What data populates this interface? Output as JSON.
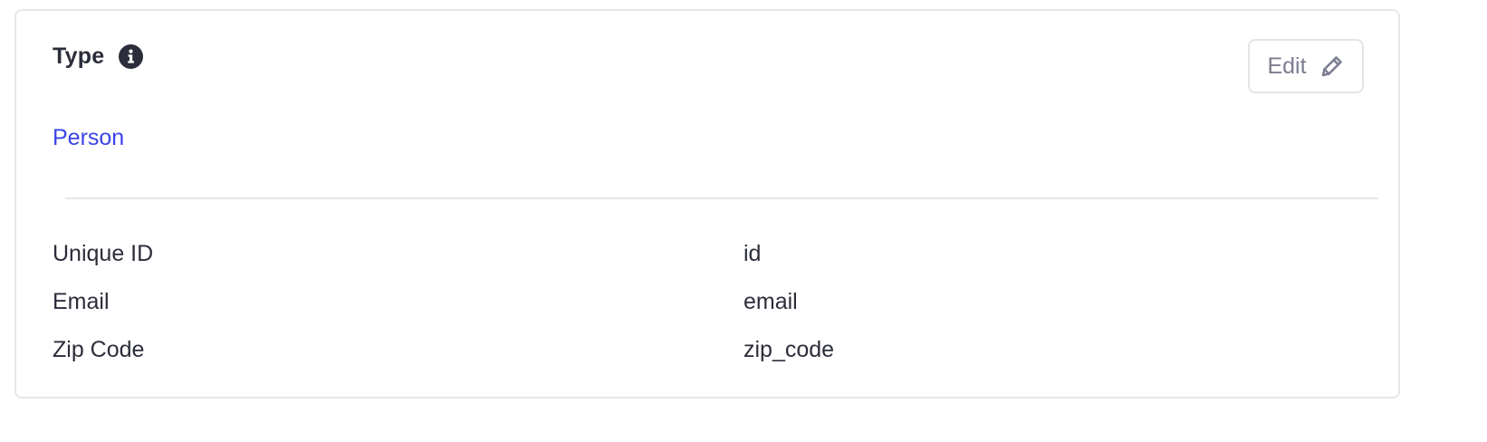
{
  "section": {
    "title": "Type",
    "info_icon": "info-icon",
    "edit_label": "Edit",
    "edit_icon": "pencil-icon",
    "type_value": "Person"
  },
  "fields": [
    {
      "label": "Unique ID",
      "value": "id"
    },
    {
      "label": "Email",
      "value": "email"
    },
    {
      "label": "Zip Code",
      "value": "zip_code"
    }
  ],
  "colors": {
    "text_primary": "#2b2d3a",
    "link": "#3b44e8",
    "muted": "#7b7d90",
    "border": "#e6e7eb"
  }
}
